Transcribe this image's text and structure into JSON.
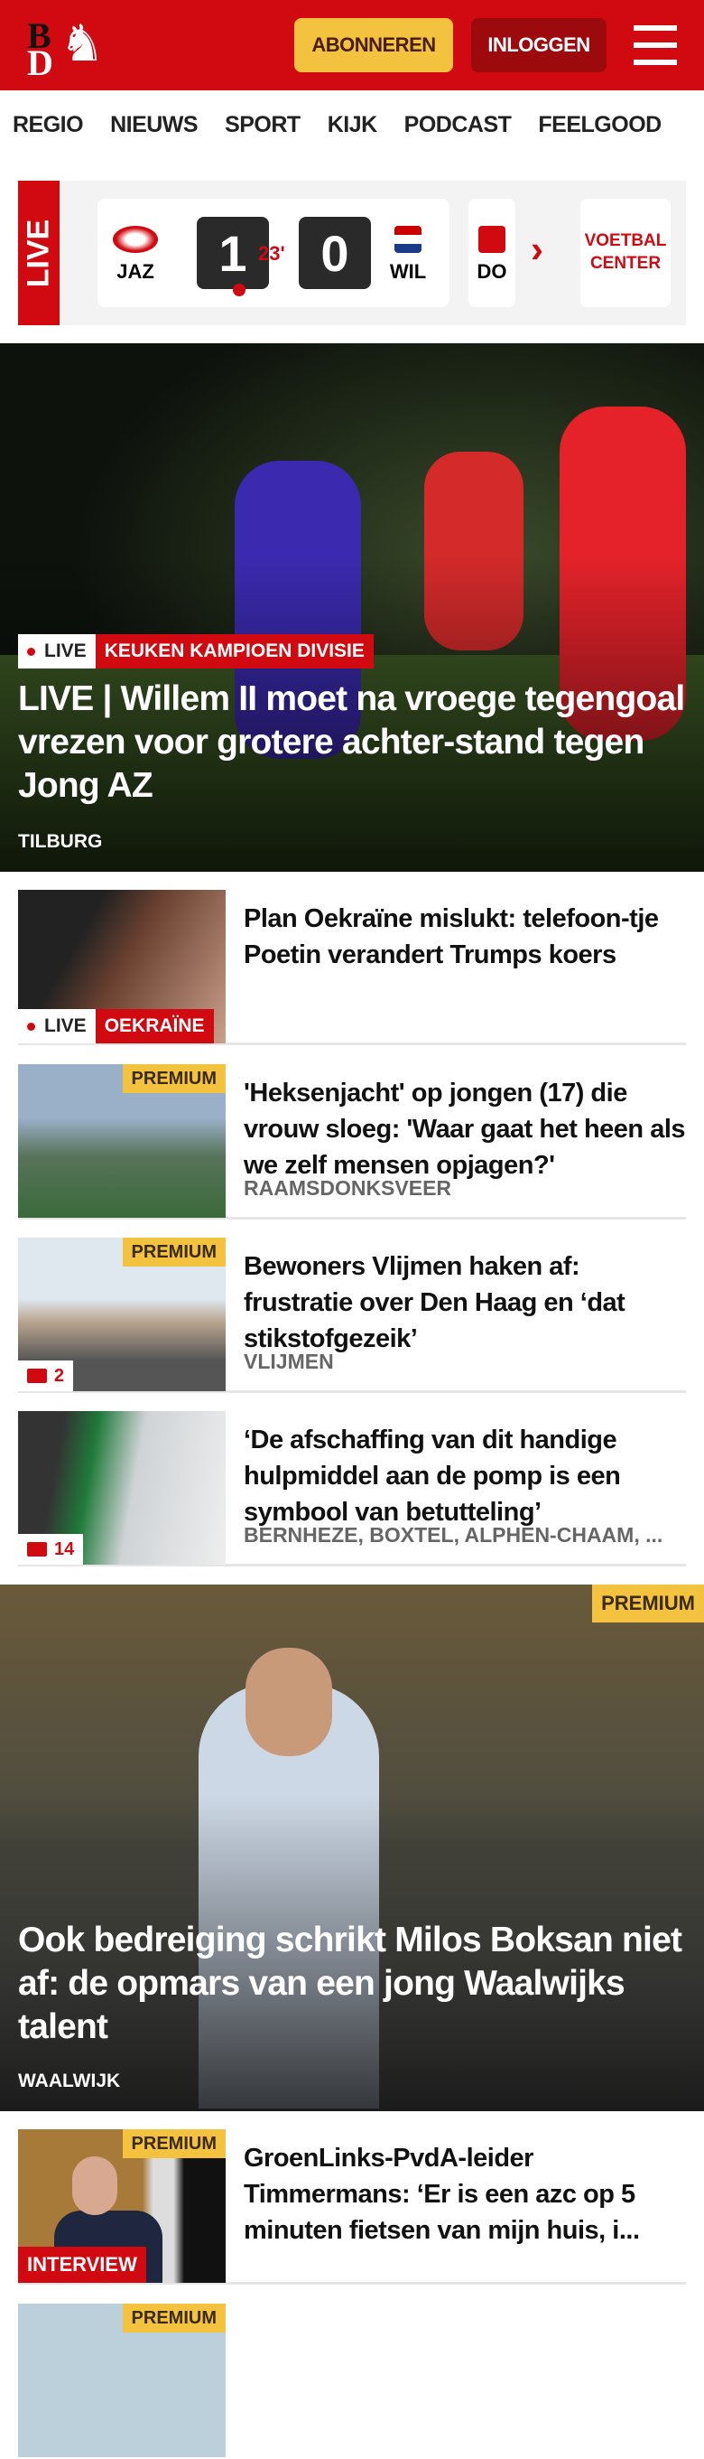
{
  "header": {
    "logo": "BD",
    "subscribe": "ABONNEREN",
    "login": "INLOGGEN",
    "brand_color": "#d10a11"
  },
  "nav": [
    "REGIO",
    "NIEUWS",
    "SPORT",
    "KIJK",
    "PODCAST",
    "FEELGOOD"
  ],
  "live": {
    "label": "LIVE",
    "match": {
      "home": "JAZ",
      "away": "WIL",
      "home_score": "1",
      "away_score": "0",
      "minute": "23'"
    },
    "next_team": "DO",
    "center": "VOETBAL CENTER"
  },
  "hero": {
    "live": "LIVE",
    "category": "KEUKEN KAMPIOEN DIVISIE",
    "title": "LIVE | Willem II moet na vroege tegengoal vrezen voor grotere achter-stand tegen Jong AZ",
    "location": "TILBURG"
  },
  "items": [
    {
      "title": "Plan Oekraïne mislukt: telefoon-tje Poetin verandert Trumps koers",
      "live": "LIVE",
      "category": "OEKRAÏNE"
    },
    {
      "title": "'Heksenjacht' op jongen (17) die vrouw sloeg: 'Waar gaat het heen als we zelf mensen opjagen?'",
      "premium": "PREMIUM",
      "location": "RAAMSDONKSVEER"
    },
    {
      "title": "Bewoners Vlijmen haken af: frustratie over Den Haag en ‘dat stikstofgezeik’",
      "premium": "PREMIUM",
      "location": "VLIJMEN",
      "comments": "2"
    },
    {
      "title": "‘De afschaffing van dit handige hulpmiddel aan de pomp is een symbool van betutteling’",
      "location": "BERNHEZE, BOXTEL, ALPHEN-CHAAM, ...",
      "comments": "14"
    }
  ],
  "hero2": {
    "premium": "PREMIUM",
    "title": "Ook bedreiging schrikt Milos Boksan niet af: de opmars van een jong Waalwijks talent",
    "location": "WAALWIJK"
  },
  "item5": {
    "premium": "PREMIUM",
    "category": "INTERVIEW",
    "title": "GroenLinks-PvdA-leider Timmermans: ‘Er is een azc op 5 minuten fietsen van mijn huis, i..."
  },
  "item6": {
    "premium": "PREMIUM"
  }
}
